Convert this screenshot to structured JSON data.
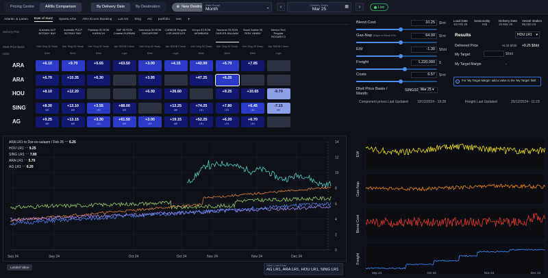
{
  "topbar": {
    "tabs": [
      "Pricing Centre",
      "ARBs Comparison"
    ],
    "active_tab": 1,
    "mode_tabs": [
      "By Delivery Date",
      "By Destination"
    ],
    "active_mode": 0,
    "new_destination": "New Destination",
    "date_range_label": "Date Range",
    "date_range_value": "Month",
    "delivery_dates_label": "Delivery Dates",
    "delivery_dates_value": "Mar 25",
    "live_label": "Live"
  },
  "subbar": {
    "items": [
      "Atlantic & Latam",
      "East of Suez",
      "Sparta Arbs",
      "ARA Econs Ranking",
      "Lat Am",
      "Sing",
      "AG",
      "portfolio",
      "test"
    ],
    "active": 1
  },
  "grid": {
    "row_header_1": "Delivery Port",
    "row_header_2": "West Price Basis",
    "row_header_3": "Units",
    "columns": [
      {
        "name": "Australia ULP BOTANY BAY",
        "basis": "Mar Sing 92 Swap",
        "unit": "$/bbl"
      },
      {
        "name": "Australia PULP BOTANY BAY",
        "basis": "Mar Sing 95 Swap",
        "unit": "$/bbl"
      },
      {
        "name": "Pakistan 92 RON KARACHI",
        "basis": "Mar Sing 92 Swap",
        "unit": "$/bbl"
      },
      {
        "name": "SAF 95 RON Coastal DURBAN",
        "basis": "Apr RBOB Future",
        "unit": "c/gal"
      },
      {
        "name": "Indonesia 90 RON SINGAPORE",
        "basis": "Mar Sing 92 Swap",
        "unit": "$/bbl"
      },
      {
        "name": "CARBOB Regular LOS ANGELES",
        "basis": "Apr RBOB Future",
        "unit": "c/gal"
      },
      {
        "name": "Kenya 93 RON MOMBASA",
        "basis": "Mar Sing 92 Swap",
        "unit": "$/bbl"
      },
      {
        "name": "Tanzania 93 RON DAR-ES-SALAAM",
        "basis": "Mar Sing 92 Swap",
        "unit": "$/bbl"
      },
      {
        "name": "Saudi Arabia 95 RON YANBU",
        "basis": "Mar Sing 95 Swap",
        "unit": "$/bbl"
      },
      {
        "name": "Mexico RoC Regular ROSARITO",
        "basis": "Apr RBOB Future",
        "unit": "c/gal"
      }
    ],
    "rows": [
      {
        "label": "ARA",
        "cells": [
          {
            "v": "+6.10",
            "t": "",
            "c": "blue"
          },
          {
            "v": "+9.70",
            "t": "",
            "c": "blue"
          },
          {
            "v": "+5.65",
            "t": "",
            "c": "dark"
          },
          {
            "v": "+63.50",
            "t": "",
            "c": "dark"
          },
          {
            "v": "+3.00",
            "t": "",
            "c": "blue"
          },
          {
            "v": "+4.15",
            "t": "",
            "c": "blue"
          },
          {
            "v": "+42.00",
            "t": "",
            "c": "blue"
          },
          {
            "v": "+5.70",
            "t": "",
            "c": "blue"
          },
          {
            "v": "+7.85",
            "t": "",
            "c": "dark"
          },
          {
            "v": "",
            "t": "",
            "c": "grey"
          }
        ]
      },
      {
        "label": "ARA",
        "cells": [
          {
            "v": "+6.70",
            "t": "",
            "c": "dark"
          },
          {
            "v": "+10.35",
            "t": "",
            "c": "dark"
          },
          {
            "v": "+6.30",
            "t": "",
            "c": "dark"
          },
          {
            "v": "",
            "t": "",
            "c": "grey"
          },
          {
            "v": "+3.95",
            "t": "",
            "c": "dark"
          },
          {
            "v": "",
            "t": "",
            "c": "grey"
          },
          {
            "v": "+47.25",
            "t": "",
            "c": "dark"
          },
          {
            "v": "+6.25",
            "t": "",
            "c": "blue"
          },
          {
            "v": "",
            "t": "",
            "c": "grey"
          },
          {
            "v": "",
            "t": "",
            "c": "grey"
          }
        ]
      },
      {
        "label": "HOU",
        "cells": [
          {
            "v": "+8.10",
            "t": "",
            "c": "dark"
          },
          {
            "v": "+12.20",
            "t": "",
            "c": "dark"
          },
          {
            "v": "",
            "t": "",
            "c": "grey"
          },
          {
            "v": "",
            "t": "",
            "c": "grey"
          },
          {
            "v": "+6.30",
            "t": "",
            "c": "dark"
          },
          {
            "v": "+26.60",
            "t": "",
            "c": "dark"
          },
          {
            "v": "",
            "t": "",
            "c": "grey"
          },
          {
            "v": "+9.25",
            "t": "",
            "c": "dark"
          },
          {
            "v": "+10.65",
            "t": "",
            "c": "dark"
          },
          {
            "v": "-9.70",
            "t": "",
            "c": "light"
          }
        ]
      },
      {
        "label": "SING",
        "cells": [
          {
            "v": "+8.30",
            "t": "MR",
            "c": "dark"
          },
          {
            "v": "+13.10",
            "t": "MR",
            "c": "dark"
          },
          {
            "v": "+3.55",
            "t": "LR1",
            "c": "blue"
          },
          {
            "v": "+88.00",
            "t": "MR",
            "c": "dark"
          },
          {
            "v": "",
            "t": "",
            "c": "grey"
          },
          {
            "v": "+13.25",
            "t": "MR",
            "c": "dark"
          },
          {
            "v": "+74.25",
            "t": "LR1",
            "c": "dark"
          },
          {
            "v": "+7.80",
            "t": "LR1",
            "c": "dark"
          },
          {
            "v": "+6.45",
            "t": "LR1",
            "c": "blue"
          },
          {
            "v": "-7.15",
            "t": "MR",
            "c": "light"
          }
        ]
      },
      {
        "label": "AG",
        "cells": [
          {
            "v": "+9.25",
            "t": "MR",
            "c": "dark"
          },
          {
            "v": "+13.15",
            "t": "MR",
            "c": "dark"
          },
          {
            "v": "+3.30",
            "t": "LR1",
            "c": "blue"
          },
          {
            "v": "+61.50",
            "t": "MR",
            "c": "blue"
          },
          {
            "v": "+3.00",
            "t": "LR1",
            "c": "blue"
          },
          {
            "v": "+19.15",
            "t": "MR",
            "c": "dark"
          },
          {
            "v": "+52.25",
            "t": "LR1",
            "c": "dark"
          },
          {
            "v": "+6.20",
            "t": "LR1",
            "c": "dark"
          },
          {
            "v": "+6.70",
            "t": "LR1",
            "c": "dark"
          },
          {
            "v": "",
            "t": "",
            "c": "grey"
          }
        ]
      }
    ]
  },
  "inputs": {
    "blend_cost_label": "Blend Cost",
    "blend_cost": "10.25",
    "blend_cost_unit": "$/mt",
    "gasnap_label": "Gas-Nap",
    "gasnap_sub": "(Naph in Blend 9%)",
    "gasnap": "64.00",
    "gasnap_unit": "$/mt",
    "ew_label": "EW",
    "ew": "-1.30",
    "ew_unit": "$/bbl",
    "freight_label": "Freight",
    "freight": "1,220,000",
    "freight_unit": "$",
    "costs_label": "Costs",
    "costs": "6.57",
    "costs_unit": "$/mt",
    "basis_label_1": "Dlvd Price Basis /",
    "basis_label_2": "Month:",
    "basis_code": "SING92",
    "basis_month": "Mar 25",
    "sliders": [
      0.55,
      0.55,
      0.55,
      0.6,
      0.55
    ]
  },
  "results": {
    "load_date_label": "Load Date",
    "load_date": "10 Feb 25",
    "seasonality_label": "Seasonality",
    "seasonality": "Mid",
    "delivery_date_label": "Delivery Date",
    "delivery_date": "15 Mar 25",
    "vessel_label": "Vessel Intakes",
    "vessel": "55,000 mt",
    "title": "Results",
    "vessel_select": "HOU LR1",
    "delivered_label": "Delivered Price",
    "delivered_a": "+6.25 $/bbl",
    "delivered_b": "+9.25 $/bbl",
    "target_label": "My Target:",
    "target_unit": "$/bbl",
    "margin_label": "My Target Margin",
    "margin_value": "-",
    "note": "For 'My Target Margin' add a value to the 'My Target' field",
    "component_label": "Component prices Last Updated",
    "component_date": "19/12/2024 - 19:28",
    "freight_label": "Freight Last Updated",
    "freight_date": "20/12/2024 - 11:23"
  },
  "main_chart": {
    "legend": [
      {
        "label": "ARA LR1 to Dar-es-salaam / Feb 25",
        "value": "6.25"
      },
      {
        "label": "HOU LR1",
        "value": "9.25"
      },
      {
        "label": "SING LR1",
        "value": "7.80"
      },
      {
        "label": "ARA LR1",
        "value": "5.70"
      },
      {
        "label": "AG LR1",
        "value": "6.20"
      }
    ],
    "x_labels": [
      "Sep 24",
      "Sep 24",
      "Oct 24",
      "Oct 24",
      "Nov 24",
      "Nov 24",
      "Dec 24"
    ],
    "y_labels": [
      "0",
      "2",
      "4",
      "6",
      "8",
      "10",
      "12",
      "14"
    ],
    "colors": {
      "teal": "#4fd1c5",
      "orange": "#e07b39",
      "green": "#9bd16a",
      "purple": "#a78bfa",
      "blue": "#4f7ff0"
    }
  },
  "footer": {
    "landed_button": "Landed Value",
    "other_ports_label": "Other Load Ports",
    "other_ports_value": "AG LR1, ARA LR1, HOU LR1, SING LR1"
  },
  "side_charts": {
    "labels": [
      "EW",
      "Gas-Nap",
      "Blend Cost",
      "Freight"
    ],
    "colors": [
      "#f2e01a",
      "#f0861a",
      "#e83a2a",
      "#3c8cff"
    ]
  }
}
